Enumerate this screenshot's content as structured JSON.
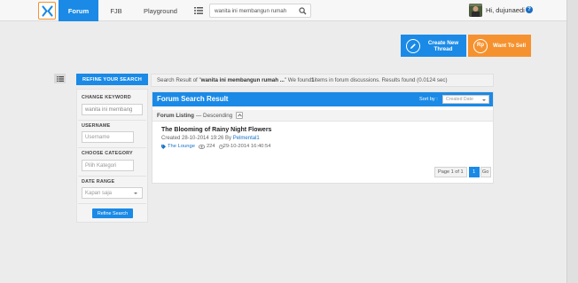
{
  "nav": {
    "tabs": [
      {
        "label": "Forum",
        "active": true
      },
      {
        "label": "FJB",
        "active": false
      },
      {
        "label": "Playground",
        "active": false
      }
    ],
    "search_value": "wanita ini membangun rumah",
    "user_greeting": "Hi, dujunaedi"
  },
  "actions": {
    "create_thread": "Create New Thread",
    "want_to_sell": "Want To Sell",
    "sell_icon_text": "Rp"
  },
  "sidebar": {
    "refine_header": "REFINE YOUR SEARCH",
    "keyword_label": "CHANGE KEYWORD",
    "keyword_value": "wanita ini membang",
    "username_label": "USERNAME",
    "username_placeholder": "Username",
    "category_label": "CHOOSE CATEGORY",
    "category_placeholder": "Pilih Kategori",
    "date_label": "DATE RANGE",
    "date_value": "Kapan saja",
    "refine_button": "Refine Search"
  },
  "summary": {
    "prefix": "Search Result of \"",
    "query": "wanita ini membangun rumah ...",
    "middle": "\" We found ",
    "count": "1",
    "suffix": " items in forum discussions. Results found (0.0124 sec)"
  },
  "results": {
    "title": "Forum Search Result",
    "sort_label": "Sort by :",
    "sort_value": "Created Date",
    "listing_label": "Forum Listing",
    "listing_order": "— Descending",
    "threads": [
      {
        "title": "The Blooming of Rainy Night Flowers",
        "created_prefix": "Created 28-10-2014 19:26 By ",
        "author": "Pelmental1",
        "tag": "The Lounge",
        "views": "224",
        "last_post": "29-10-2014 16:40:54"
      }
    ],
    "pager": {
      "info": "Page 1 of 1",
      "current": "1",
      "go": "Go"
    }
  },
  "colors": {
    "primary": "#1a8ae6",
    "accent": "#f5922f"
  }
}
